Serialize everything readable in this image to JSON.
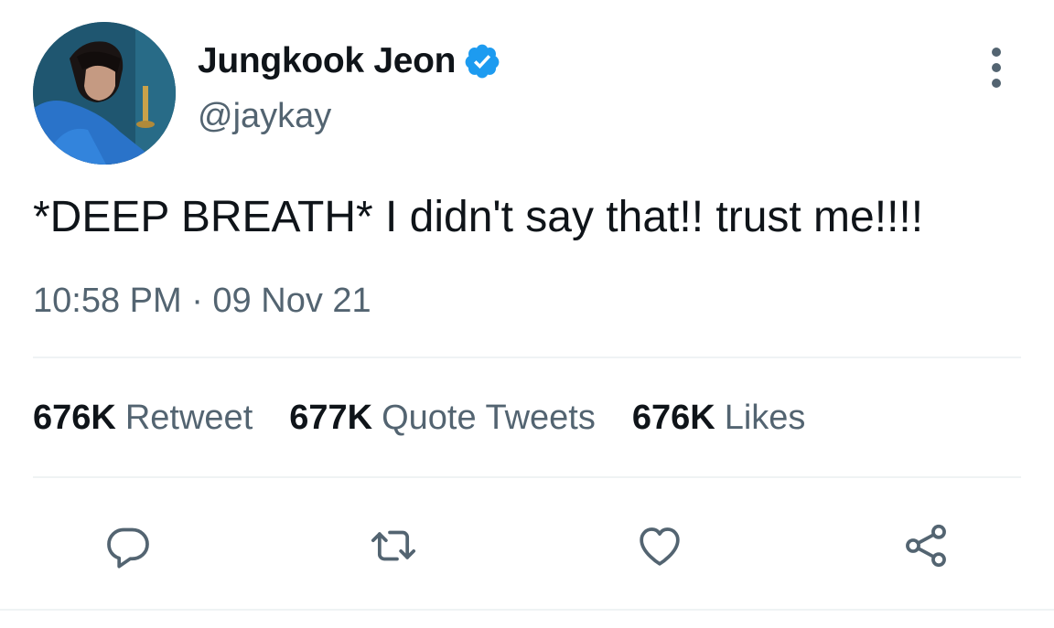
{
  "author": {
    "display_name": "Jungkook Jeon",
    "handle": "@jaykay",
    "verified": true,
    "avatar_icon": "profile-photo"
  },
  "tweet": {
    "text": "*DEEP BREATH* I didn't say that!! trust me!!!!",
    "timestamp": "10:58 PM · 09 Nov 21"
  },
  "stats": [
    {
      "count": "676K",
      "label": "Retweet"
    },
    {
      "count": "677K",
      "label": "Quote Tweets"
    },
    {
      "count": "676K",
      "label": "Likes"
    }
  ],
  "actions": [
    {
      "name": "reply",
      "icon": "comment-bubble-icon"
    },
    {
      "name": "retweet",
      "icon": "retweet-arrows-icon"
    },
    {
      "name": "like",
      "icon": "heart-icon"
    },
    {
      "name": "share",
      "icon": "share-nodes-icon"
    }
  ],
  "colors": {
    "text_primary": "#0f1419",
    "text_secondary": "#536471",
    "verified_blue": "#1d9bf0",
    "divider": "#eff3f4"
  }
}
